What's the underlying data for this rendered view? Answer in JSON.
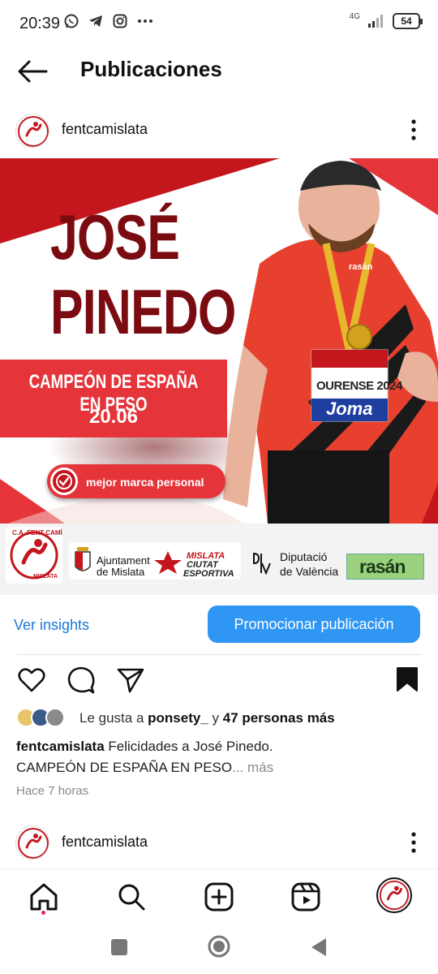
{
  "status_bar": {
    "time": "20:39",
    "network": "4G",
    "battery": "54",
    "notification_icons": [
      "whatsapp-icon",
      "telegram-icon",
      "instagram-icon",
      "more-dots-icon"
    ]
  },
  "header": {
    "title": "Publicaciones",
    "back_icon": "arrow-left-icon"
  },
  "post": {
    "username": "fentcamislata",
    "avatar_text": "C.A. FENT CAMÍ MISLATA",
    "image": {
      "name_line1": "JOSÉ",
      "name_line2": "PINEDO",
      "band_line1": "CAMPEÓN DE ESPAÑA EN PESO",
      "band_line2": "20.06",
      "badge_text": "mejor marca personal",
      "bib_text": "OURENSE 2024",
      "bib_brand": "Joma",
      "shirt_brand": "rasán",
      "sponsors": {
        "club_top": "C.A. FENT CAMÍ",
        "club_bottom": "MISLATA",
        "ayuntamiento_line1": "Ajuntament",
        "ayuntamiento_line2": "de Mislata",
        "mislata_line1": "MISLATA",
        "mislata_line2": "CIUTAT",
        "mislata_line3": "ESPORTIVA",
        "diputacio_line1": "Diputació",
        "diputacio_line2": "de València",
        "rasan": "rasán"
      }
    },
    "insights_label": "Ver insights",
    "promote_label": "Promocionar publicación",
    "likes": {
      "prefix": "Le gusta a",
      "user": "ponsety_",
      "connector": "y",
      "others": "47 personas más"
    },
    "caption": {
      "user": "fentcamislata",
      "text_line1": "Felicidades a José Pinedo.",
      "text_line2": "CAMPEÓN DE ESPAÑA EN PESO",
      "ellipsis": "...",
      "more": "más"
    },
    "timestamp": "Hace 7 horas"
  },
  "next_post": {
    "username": "fentcamislata"
  },
  "bottom_nav": [
    "home-icon",
    "search-icon",
    "create-icon",
    "reels-icon",
    "profile-icon"
  ],
  "colors": {
    "accent_blue": "#2f96f4",
    "link_blue": "#1877d6",
    "brand_red": "#e5353b",
    "dark_red": "#7a0b10"
  }
}
